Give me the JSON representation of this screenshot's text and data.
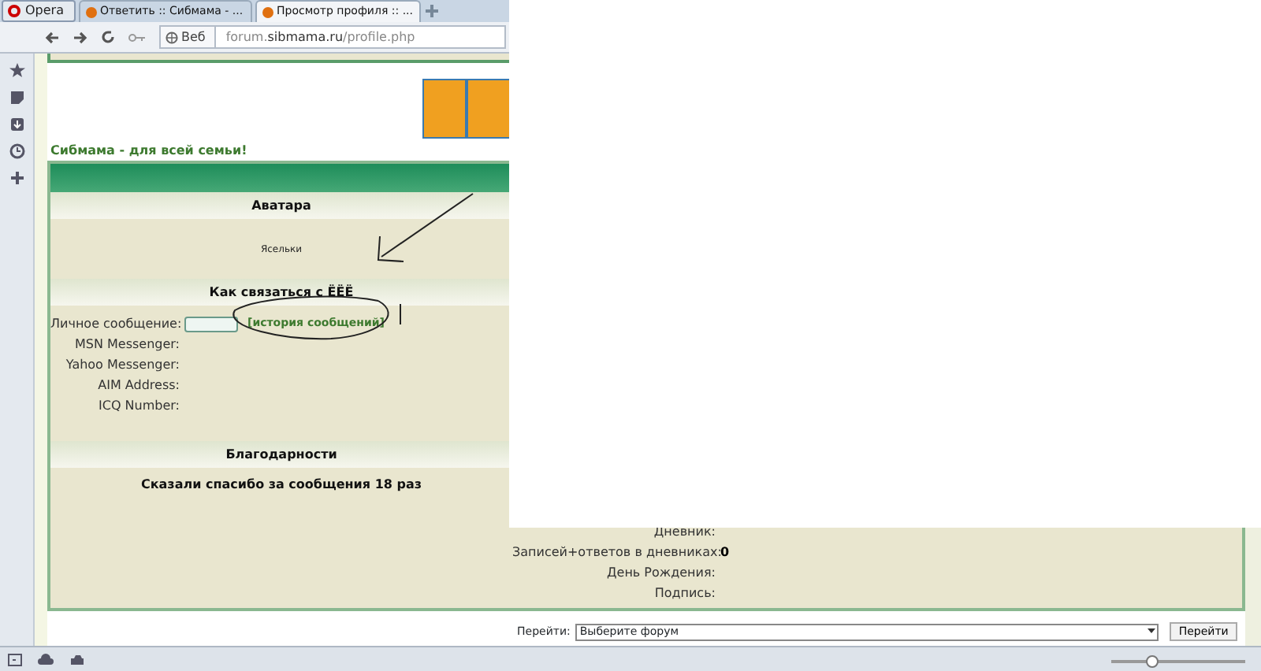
{
  "browser": {
    "opera_button": "Opera",
    "tabs": [
      {
        "title": "Ответить :: Сибмама - ...",
        "selected": false
      },
      {
        "title": "Просмотр профиля :: ...",
        "selected": true
      }
    ],
    "web_button": "Веб",
    "url": "forum.**sibmama.ru**/profile.php",
    "zoom": {
      "level": 0.3
    }
  },
  "page": {
    "slogan": "Сибмама - для всей семьи!",
    "avatar": {
      "heading": "Аватара",
      "caption": "Ясельки"
    },
    "contact": {
      "heading": "Как связаться с ЁЁЁ",
      "rows": [
        {
          "label": "Личное сообщение:",
          "kind": "pm",
          "link": "[история сообщений]"
        },
        {
          "label": "MSN Messenger:",
          "kind": "text"
        },
        {
          "label": "Yahoo Messenger:",
          "kind": "text"
        },
        {
          "label": "AIM Address:",
          "kind": "text"
        },
        {
          "label": "ICQ Number:",
          "kind": "text"
        }
      ]
    },
    "thanks": {
      "heading": "Благодарности",
      "text": "Сказали спасибо за сообщения 18 раз"
    },
    "details": [
      {
        "label": "Дневник:"
      },
      {
        "label": "Записей+ответов в дневниках:",
        "value": "0"
      },
      {
        "label": "День Рождения:"
      },
      {
        "label": "Подпись:"
      }
    ],
    "jump": {
      "label": "Перейти:",
      "select": "Выберите форум",
      "button": "Перейти"
    }
  }
}
